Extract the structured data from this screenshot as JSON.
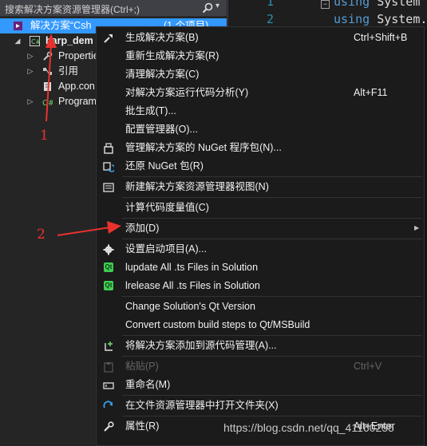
{
  "search": {
    "placeholder": "搜索解决方案资源管理器(Ctrl+;)"
  },
  "tree": [
    {
      "label": "解决方案“Csh",
      "suffix": "(1 个项目)",
      "selected": true,
      "indent": 0,
      "icon": "solution-icon",
      "expand": ""
    },
    {
      "label": "harp_dem",
      "indent": 1,
      "icon": "csharp-project-icon",
      "expand": "◢",
      "bold": true
    },
    {
      "label": "Propertie",
      "indent": 2,
      "icon": "wrench-icon",
      "expand": "▷"
    },
    {
      "label": "引用",
      "indent": 2,
      "icon": "references-icon",
      "expand": "▷"
    },
    {
      "label": "App.con",
      "indent": 2,
      "icon": "config-file-icon",
      "expand": ""
    },
    {
      "label": "Program",
      "indent": 2,
      "icon": "csharp-file-icon",
      "expand": "▷"
    }
  ],
  "editor": {
    "lines": [
      {
        "num": "1",
        "kw": "using",
        "text": "System"
      },
      {
        "num": "2",
        "kw": "using",
        "text": "System."
      }
    ]
  },
  "menu": [
    {
      "label": "生成解决方案(B)",
      "shortcut": "Ctrl+Shift+B",
      "icon": "build-icon"
    },
    {
      "label": "重新生成解决方案(R)"
    },
    {
      "label": "清理解决方案(C)"
    },
    {
      "label": "对解决方案运行代码分析(Y)",
      "shortcut": "Alt+F11"
    },
    {
      "label": "批生成(T)..."
    },
    {
      "label": "配置管理器(O)..."
    },
    {
      "label": "管理解决方案的 NuGet 程序包(N)...",
      "icon": "nuget-package-icon"
    },
    {
      "label": "还原 NuGet 包(R)",
      "icon": "restore-icon"
    },
    {
      "sep": true
    },
    {
      "label": "新建解决方案资源管理器视图(N)",
      "icon": "new-view-icon"
    },
    {
      "sep": true
    },
    {
      "label": "计算代码度量值(C)"
    },
    {
      "sep": true
    },
    {
      "label": "添加(D)",
      "submenu": true
    },
    {
      "sep": true
    },
    {
      "label": "设置启动项目(A)...",
      "icon": "gear-icon"
    },
    {
      "label": "lupdate All .ts Files in Solution",
      "icon": "qt-icon"
    },
    {
      "label": "lrelease All .ts Files in Solution",
      "icon": "qt-icon"
    },
    {
      "sep": true
    },
    {
      "label": "Change Solution's Qt Version"
    },
    {
      "label": "Convert custom build steps to Qt/MSBuild"
    },
    {
      "sep": true
    },
    {
      "label": "将解决方案添加到源代码管理(A)...",
      "icon": "add-source-control-icon"
    },
    {
      "sep": true
    },
    {
      "label": "粘贴(P)",
      "shortcut": "Ctrl+V",
      "icon": "paste-icon",
      "disabled": true
    },
    {
      "label": "重命名(M)",
      "icon": "rename-icon"
    },
    {
      "sep": true
    },
    {
      "label": "在文件资源管理器中打开文件夹(X)",
      "icon": "open-folder-icon"
    },
    {
      "sep": true
    },
    {
      "label": "属性(R)",
      "shortcut": "Alt+Enter",
      "icon": "properties-icon"
    }
  ],
  "annotations": {
    "n1": "1",
    "n2": "2"
  },
  "watermark": "https://blog.csdn.net/qq_41160255",
  "colors": {
    "selection": "#3399ff",
    "annotation": "#e8332d",
    "qt": "#41cd52"
  }
}
